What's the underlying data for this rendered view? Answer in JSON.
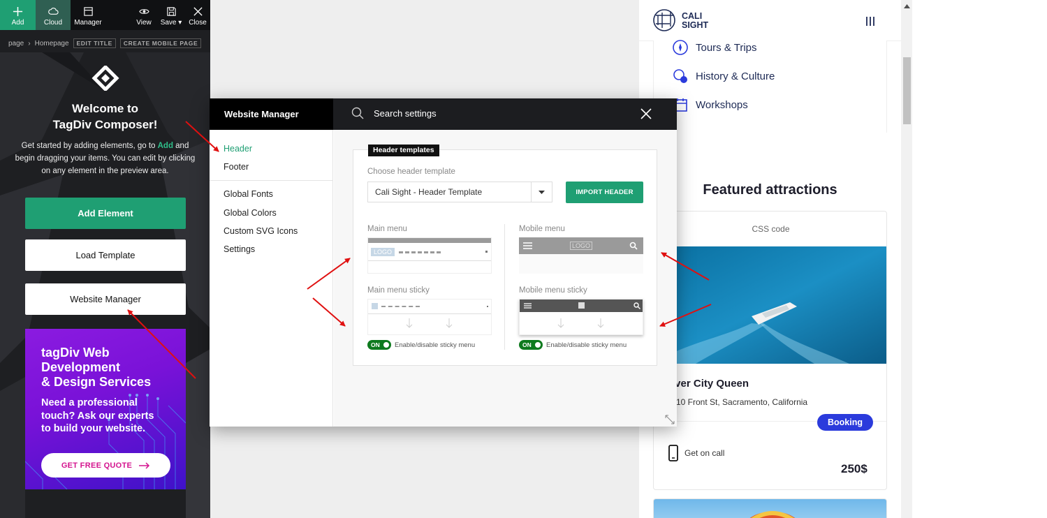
{
  "toolbar": {
    "add": "Add",
    "cloud": "Cloud",
    "manager": "Manager",
    "view": "View",
    "save": "Save",
    "close": "Close"
  },
  "breadcrumb": {
    "part1": "page",
    "part2": "Homepage",
    "edit_title": "EDIT TITLE",
    "create_mobile": "CREATE MOBILE PAGE"
  },
  "welcome": {
    "line1": "Welcome to",
    "line2": "TagDiv Composer!",
    "text_before": "Get started by adding elements, go to ",
    "text_add": "Add",
    "text_after": " and begin dragging your items. You can edit by clicking on any element in the preview area."
  },
  "left_buttons": {
    "add_element": "Add Element",
    "load_template": "Load Template",
    "website_manager": "Website Manager"
  },
  "promo": {
    "title_l1": "tagDiv Web",
    "title_l2": "Development",
    "title_l3": "& Design Services",
    "sub_l1": "Need a professional",
    "sub_l2": "touch? Ask our experts",
    "sub_l3": "to build your website.",
    "cta": "GET FREE QUOTE"
  },
  "modal": {
    "title": "Website Manager",
    "search_placeholder": "Search settings",
    "nav": [
      "Header",
      "Footer",
      "Global Fonts",
      "Global Colors",
      "Custom SVG Icons",
      "Settings"
    ],
    "active_nav": "Header",
    "card_tag": "Header templates",
    "choose_label": "Choose header template",
    "selected_template": "Cali Sight - Header Template",
    "import_button": "IMPORT HEADER",
    "main_menu": "Main menu",
    "mobile_menu": "Mobile menu",
    "main_menu_sticky": "Main menu sticky",
    "mobile_menu_sticky": "Mobile menu sticky",
    "toggle_on": "ON",
    "toggle_label": "Enable/disable sticky menu",
    "logo_text": "LOGO"
  },
  "preview": {
    "brand_l1": "CALI",
    "brand_l2": "SIGHT",
    "menu_items": [
      "Tours & Trips",
      "History & Culture",
      "Workshops"
    ],
    "section_title": "Featured attractions",
    "css_code": "CSS code",
    "card_title": "iver City Queen",
    "card_address": "10 Front St, Sacramento, California",
    "badge": "Booking",
    "call": "Get on call",
    "price": "250$"
  },
  "colors": {
    "accent_green": "#1f9f73",
    "promo_purple": "#7a12d8",
    "booking_blue": "#2b3bdc",
    "arrow_red": "#e01010"
  }
}
